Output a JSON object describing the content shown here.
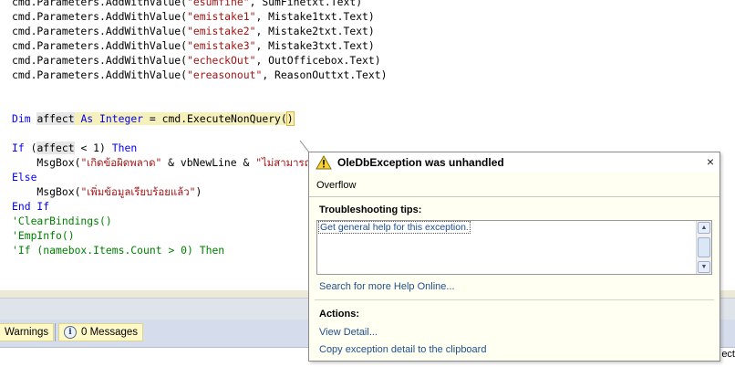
{
  "code": {
    "line1": {
      "pre": "cmd.Parameters.AddWithValue(",
      "str": "\"esumfine\"",
      "post": ", SumFinetxt.Text)"
    },
    "line2": {
      "pre": "cmd.Parameters.AddWithValue(",
      "str": "\"emistake1\"",
      "post": ", Mistake1txt.Text)"
    },
    "line3": {
      "pre": "cmd.Parameters.AddWithValue(",
      "str": "\"emistake2\"",
      "post": ", Mistake2txt.Text)"
    },
    "line4": {
      "pre": "cmd.Parameters.AddWithValue(",
      "str": "\"emistake3\"",
      "post": ", Mistake3txt.Text)"
    },
    "line5": {
      "pre": "cmd.Parameters.AddWithValue(",
      "str": "\"echeckOut\"",
      "post": ", OutOfficebox.Text)"
    },
    "line6": {
      "pre": "cmd.Parameters.AddWithValue(",
      "str": "\"ereasonout\"",
      "post": ", ReasonOuttxt.Text)"
    },
    "dim_kw": "Dim",
    "dim_var": "affect",
    "dim_as": "As",
    "dim_type": "Integer",
    "dim_rest": "= cmd.ExecuteNonQuery",
    "dim_open": "(",
    "dim_close": ")",
    "if_kw": "If",
    "if_open": "(",
    "if_var": "affect",
    "if_cond": " < 1) ",
    "then_kw": "Then",
    "msg1_pre": "    MsgBox(",
    "msg1_str": "\"เกิดข้อผิดพลาด\"",
    "msg1_mid": " & vbNewLine & ",
    "msg1_str2": "\"ไม่สามารถแ",
    "else_kw": "Else",
    "msg2_pre": "    MsgBox(",
    "msg2_str": "\"เพิ่มข้อมูลเรียบร้อยแล้ว\"",
    "msg2_post": ")",
    "endif": "End If",
    "cmt1": "'ClearBindings()",
    "cmt2": "'EmpInfo()",
    "cmt3": "'If (namebox.Items.Count > 0) Then"
  },
  "error_list": {
    "warnings_label": "Warnings",
    "messages_label": "0 Messages",
    "clipped_text": "ect"
  },
  "exception": {
    "title": "OleDbException was unhandled",
    "message": "Overflow",
    "tips_heading": "Troubleshooting tips:",
    "tip_link": "Get general help for this exception.",
    "search_link": "Search for more Help Online...",
    "actions_heading": "Actions:",
    "view_detail": "View Detail...",
    "copy_detail": "Copy exception detail to the clipboard",
    "close_glyph": "×"
  },
  "colors": {
    "keyword": "#0000ff",
    "string": "#a31515",
    "comment": "#008000",
    "link": "#1f4f8f"
  }
}
